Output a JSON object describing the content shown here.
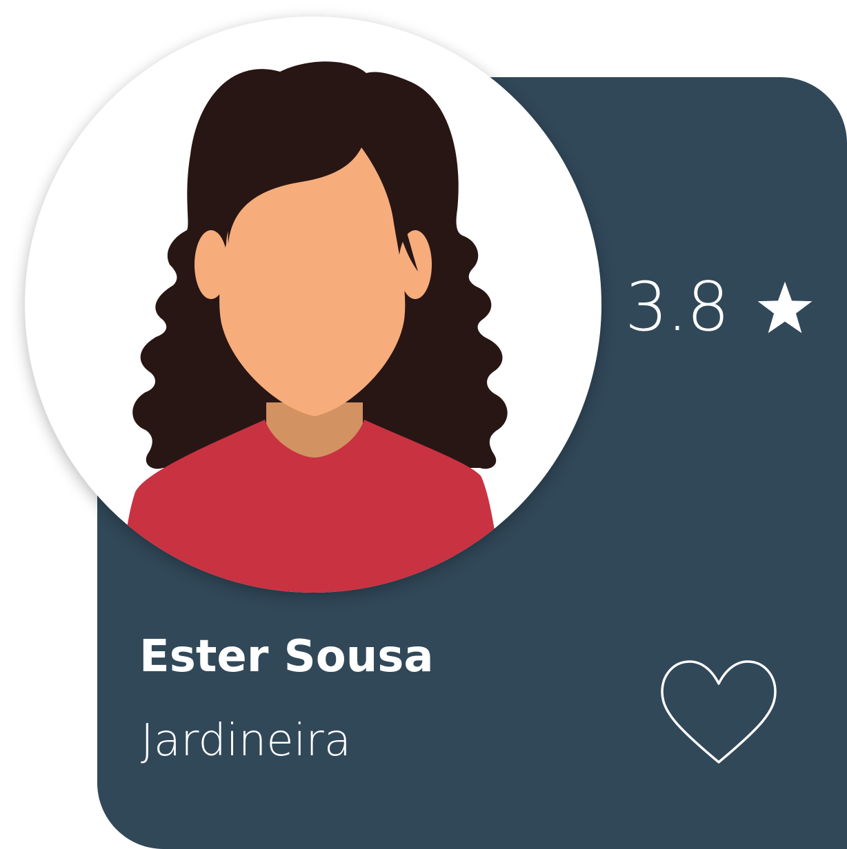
{
  "profile": {
    "name": "Ester Sousa",
    "role": "Jardineira",
    "rating": "3.8"
  },
  "icons": {
    "rating": "star-icon",
    "favorite": "heart-outline-icon"
  },
  "colors": {
    "card_background": "#314859",
    "text": "#ffffff",
    "avatar_background": "#ffffff",
    "hair": "#281615",
    "skin": "#f6ad7b",
    "neck": "#d29262",
    "shirt": "#c93241"
  }
}
